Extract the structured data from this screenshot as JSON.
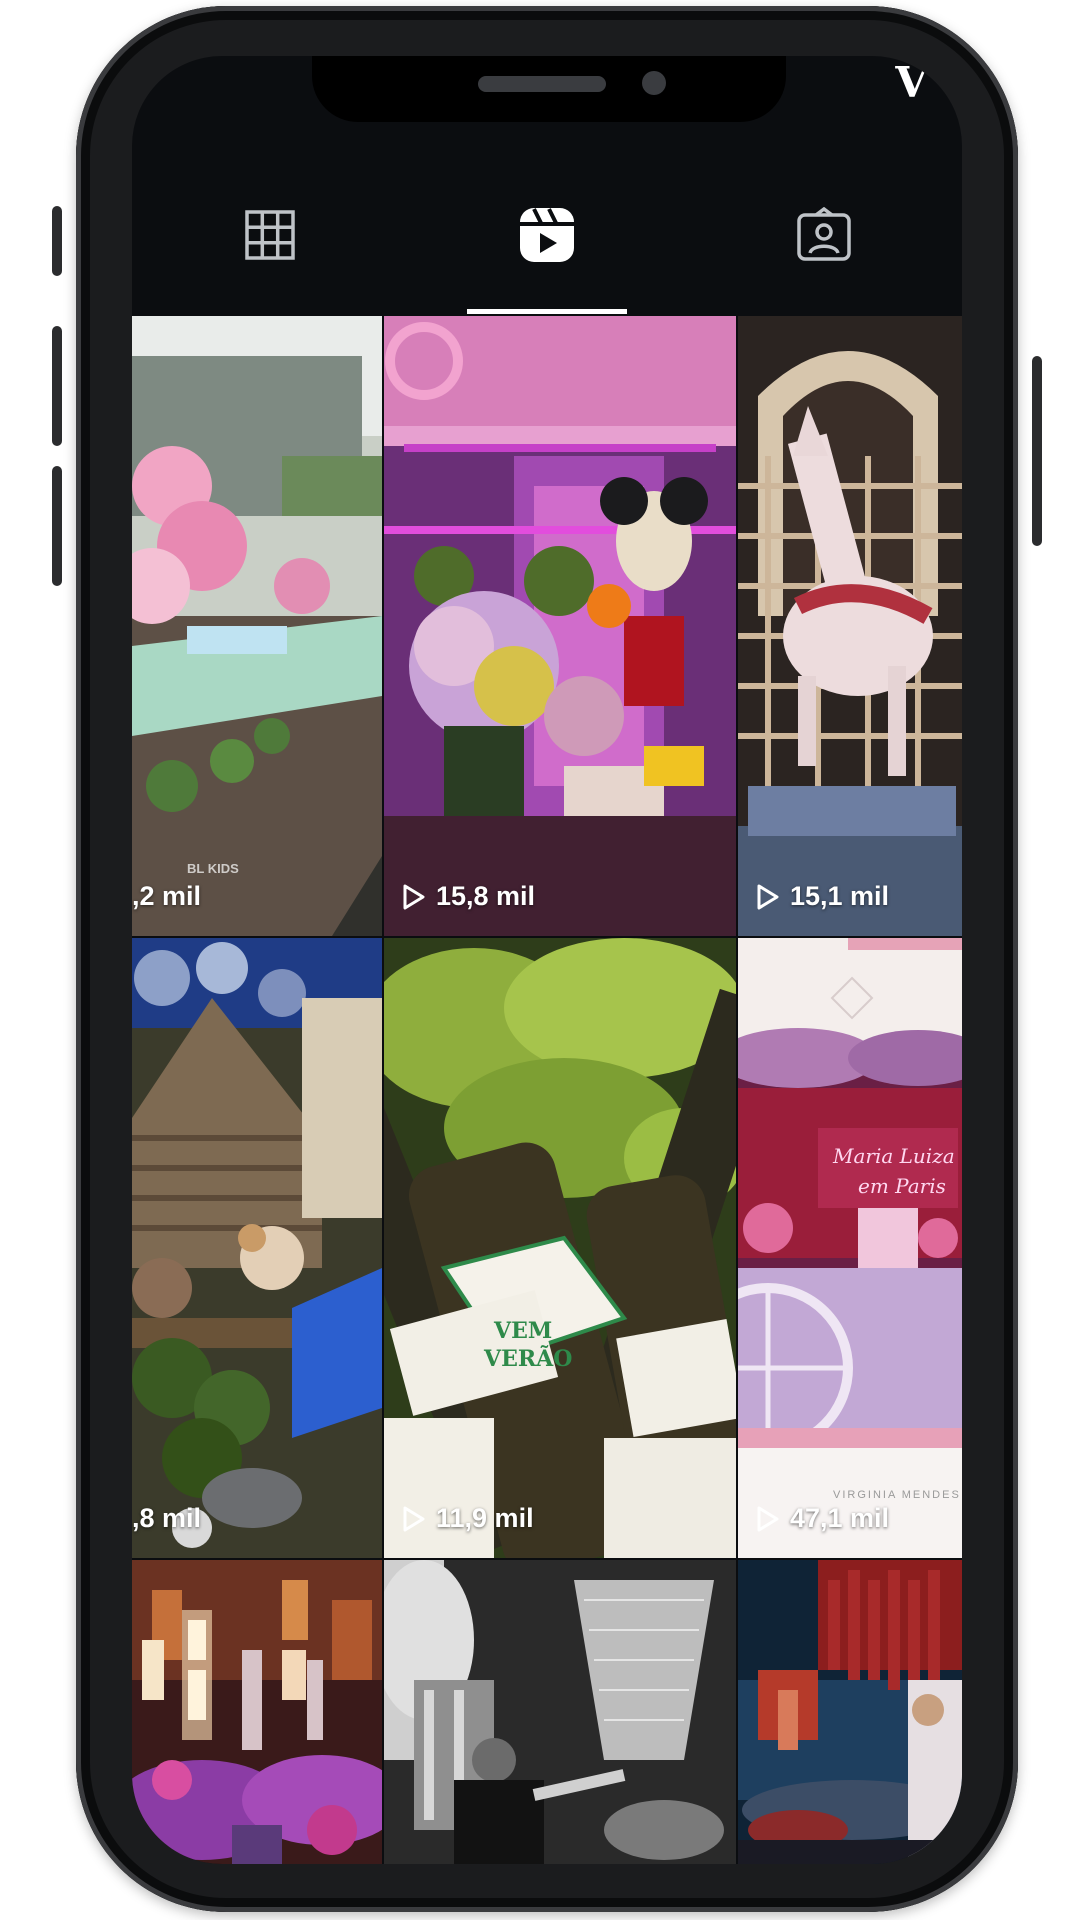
{
  "brand": {
    "corner_glyph": "V"
  },
  "tabs": [
    {
      "name": "grid",
      "icon": "grid-icon",
      "active": false
    },
    {
      "name": "reels",
      "icon": "reels-icon",
      "active": true
    },
    {
      "name": "tagged",
      "icon": "tagged-icon",
      "active": false
    }
  ],
  "reels": [
    {
      "views": ",2 mil",
      "watermark": "BL KIDS",
      "show_play": false
    },
    {
      "views": "15,8 mil",
      "show_play": true
    },
    {
      "views": "15,1 mil",
      "show_play": true
    },
    {
      "views": ",8 mil",
      "show_play": false
    },
    {
      "views": "11,9 mil",
      "show_play": true,
      "label_lines": [
        "VEM",
        "VERÃO"
      ]
    },
    {
      "views": "47,1 mil",
      "show_play": true,
      "sign_lines": [
        "Maria Luiza",
        "em Paris"
      ],
      "watermark": "VIRGINIA MENDES"
    },
    {
      "views": ""
    },
    {
      "views": ""
    },
    {
      "views": ""
    }
  ],
  "colors": {
    "background": "#0b0d10",
    "text": "#ffffff",
    "accent_pink": "#e85ab8"
  }
}
